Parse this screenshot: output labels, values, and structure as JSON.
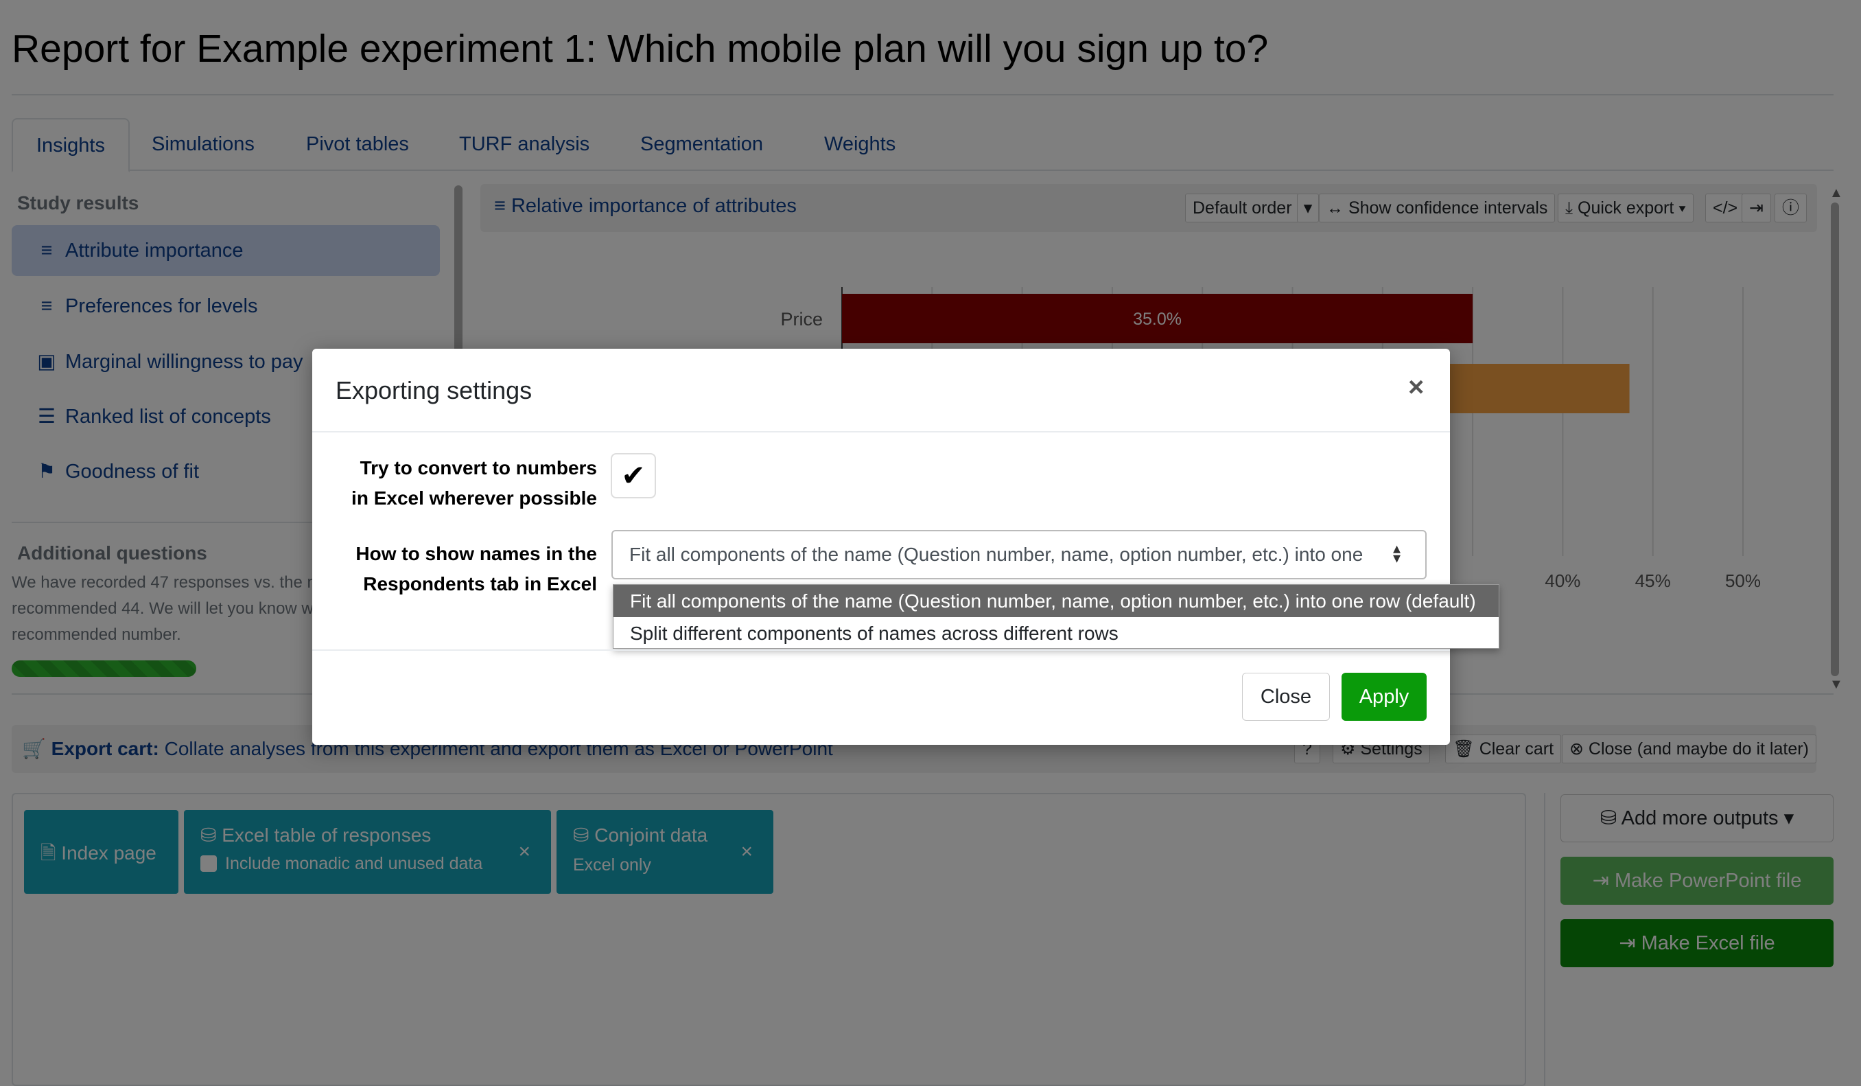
{
  "page": {
    "title": "Report for Example experiment 1: Which mobile plan will you sign up to?"
  },
  "tabs": [
    {
      "label": "Insights"
    },
    {
      "label": "Simulations"
    },
    {
      "label": "Pivot tables"
    },
    {
      "label": "TURF analysis"
    },
    {
      "label": "Segmentation"
    },
    {
      "label": "Weights"
    }
  ],
  "sidebar": {
    "heading": "Study results",
    "items": [
      {
        "label": "Attribute importance"
      },
      {
        "label": "Preferences for levels"
      },
      {
        "label": "Marginal willingness to pay"
      },
      {
        "label": "Ranked list of concepts"
      },
      {
        "label": "Goodness of fit"
      }
    ],
    "additional_heading": "Additional questions",
    "note": "We have recorded 47 responses vs. the minimum recommended 44. We will let you know when we reach the recommended number.",
    "progress": 0.42
  },
  "chart_panel": {
    "title": "Relative importance of attributes",
    "toolbar": {
      "order": "Default order",
      "ci": "Show confidence intervals",
      "export": "Quick export"
    }
  },
  "chart_data": {
    "type": "bar",
    "orientation": "horizontal",
    "categories": [
      "Price",
      ""
    ],
    "values": [
      35.0,
      43.7
    ],
    "data_labels": [
      "35.0%",
      ""
    ],
    "colors": [
      "#8b0000",
      "#f5a142"
    ],
    "xlim": [
      0,
      50
    ],
    "x_tick_labels": [
      "40%",
      "45%",
      "50%"
    ],
    "x_tick_values": [
      40,
      45,
      50
    ],
    "grid": true
  },
  "export_cart": {
    "label": "Export cart:",
    "description": "Collate analyses from this experiment and export them as Excel or PowerPoint",
    "settings": "Settings",
    "clear": "Clear cart",
    "close": "Close (and maybe do it later)",
    "items": [
      {
        "title": "Index page"
      },
      {
        "title": "Excel table of responses",
        "sub": "Include monadic and unused data"
      },
      {
        "title": "Conjoint data",
        "sub": "Excel only"
      }
    ],
    "add_outputs": "Add more outputs",
    "make_ppt": "Make PowerPoint file",
    "make_excel": "Make Excel file"
  },
  "modal": {
    "title": "Exporting settings",
    "convert_label_1": "Try to convert to numbers",
    "convert_label_2": "in Excel wherever possible",
    "convert_checked": true,
    "names_label_1": "How to show names in the",
    "names_label_2": "Respondents tab in Excel",
    "select_value": "Fit all components of the name (Question number, name, option number, etc.) into one",
    "options": [
      "Fit all components of the name (Question number, name, option number, etc.) into one row (default)",
      "Split different components of names across different rows"
    ],
    "close_label": "Close",
    "apply_label": "Apply"
  }
}
